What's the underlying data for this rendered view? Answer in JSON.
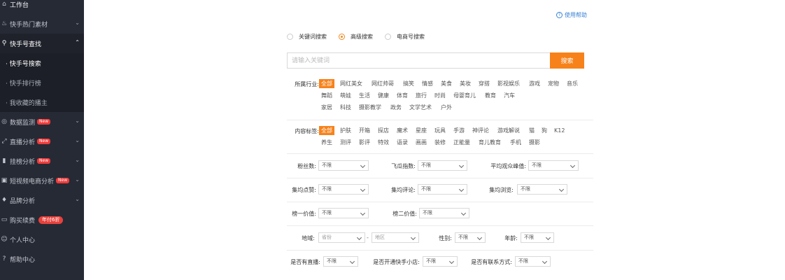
{
  "sidebar": {
    "items": [
      {
        "label": "工作台",
        "icon": "home-icon"
      },
      {
        "label": "快手热门素材",
        "icon": "fire-icon"
      },
      {
        "label": "快手号查找",
        "icon": "search-icon"
      },
      {
        "label": "· 快手号搜索"
      },
      {
        "label": "· 快手排行榜"
      },
      {
        "label": "· 我收藏的播主"
      },
      {
        "label": "数据监测",
        "icon": "monitor-icon",
        "badge": "New"
      },
      {
        "label": "直播分析",
        "icon": "live-icon",
        "badge": "New"
      },
      {
        "label": "挂榜分析",
        "icon": "bar-chart-icon",
        "badge": "New"
      },
      {
        "label": "短视频电商分析",
        "icon": "shop-bag-icon",
        "badge": "New"
      },
      {
        "label": "品牌分析",
        "icon": "diamond-icon"
      },
      {
        "label": "购买续费",
        "icon": "card-icon",
        "badge": "年付6折"
      },
      {
        "label": "个人中心",
        "icon": "user-icon"
      },
      {
        "label": "帮助中心",
        "icon": "help-circle-icon"
      }
    ]
  },
  "help_link": "使用帮助",
  "search_types": [
    {
      "label": "关键词搜索",
      "selected": false
    },
    {
      "label": "高级搜索",
      "selected": true
    },
    {
      "label": "电商号搜索",
      "selected": false
    }
  ],
  "search": {
    "placeholder": "请输入关键词",
    "button": "搜索"
  },
  "industry": {
    "label": "所属行业:",
    "tags": [
      "全部",
      "网红美女",
      "网红帅哥",
      "搞笑",
      "情感",
      "美食",
      "美妆",
      "穿搭",
      "影视娱乐",
      "游戏",
      "宠物",
      "音乐",
      "舞蹈",
      "萌娃",
      "生活",
      "健康",
      "体育",
      "旅行",
      "时尚",
      "母婴育儿",
      "教育",
      "汽车",
      "家居",
      "科技",
      "摄影教学",
      "政务",
      "文学艺术",
      "户外"
    ]
  },
  "content_tags": {
    "label": "内容标签:",
    "tags": [
      "全部",
      "护肤",
      "开箱",
      "探店",
      "魔术",
      "星座",
      "玩具",
      "手游",
      "神评论",
      "游戏解说",
      "猫",
      "狗",
      "K12",
      "养生",
      "测评",
      "影评",
      "特效",
      "语录",
      "画画",
      "装修",
      "正能量",
      "育儿教育",
      "手机",
      "摄影"
    ]
  },
  "filters": {
    "fans": {
      "label": "粉丝数:",
      "value": "不限"
    },
    "feigua": {
      "label": "飞瓜指数:",
      "value": "不限"
    },
    "avg_viewers": {
      "label": "平均观众峰值:",
      "value": "不限"
    },
    "avg_likes": {
      "label": "集均点赞:",
      "value": "不限"
    },
    "avg_comments": {
      "label": "集均评论:",
      "value": "不限"
    },
    "avg_views": {
      "label": "集均浏览:",
      "value": "不限"
    },
    "rank1": {
      "label": "榜一价值:",
      "value": "不限"
    },
    "rank2": {
      "label": "榜二价值:",
      "value": "不限"
    },
    "region": {
      "label": "地域:",
      "province": "省份",
      "dash": "-",
      "district": "地区"
    },
    "gender": {
      "label": "性别:",
      "value": "不限"
    },
    "age": {
      "label": "年龄:",
      "value": "不限"
    },
    "has_live": {
      "label": "是否有直播:",
      "value": "不限"
    },
    "has_shop": {
      "label": "是否开通快手小店:",
      "value": "不限"
    },
    "has_contact": {
      "label": "是否有联系方式:",
      "value": "不限"
    }
  },
  "colors": {
    "accent": "#f7821b",
    "sidebar_bg": "#262a35",
    "link": "#3b82d6",
    "badge": "#f03b3b"
  }
}
